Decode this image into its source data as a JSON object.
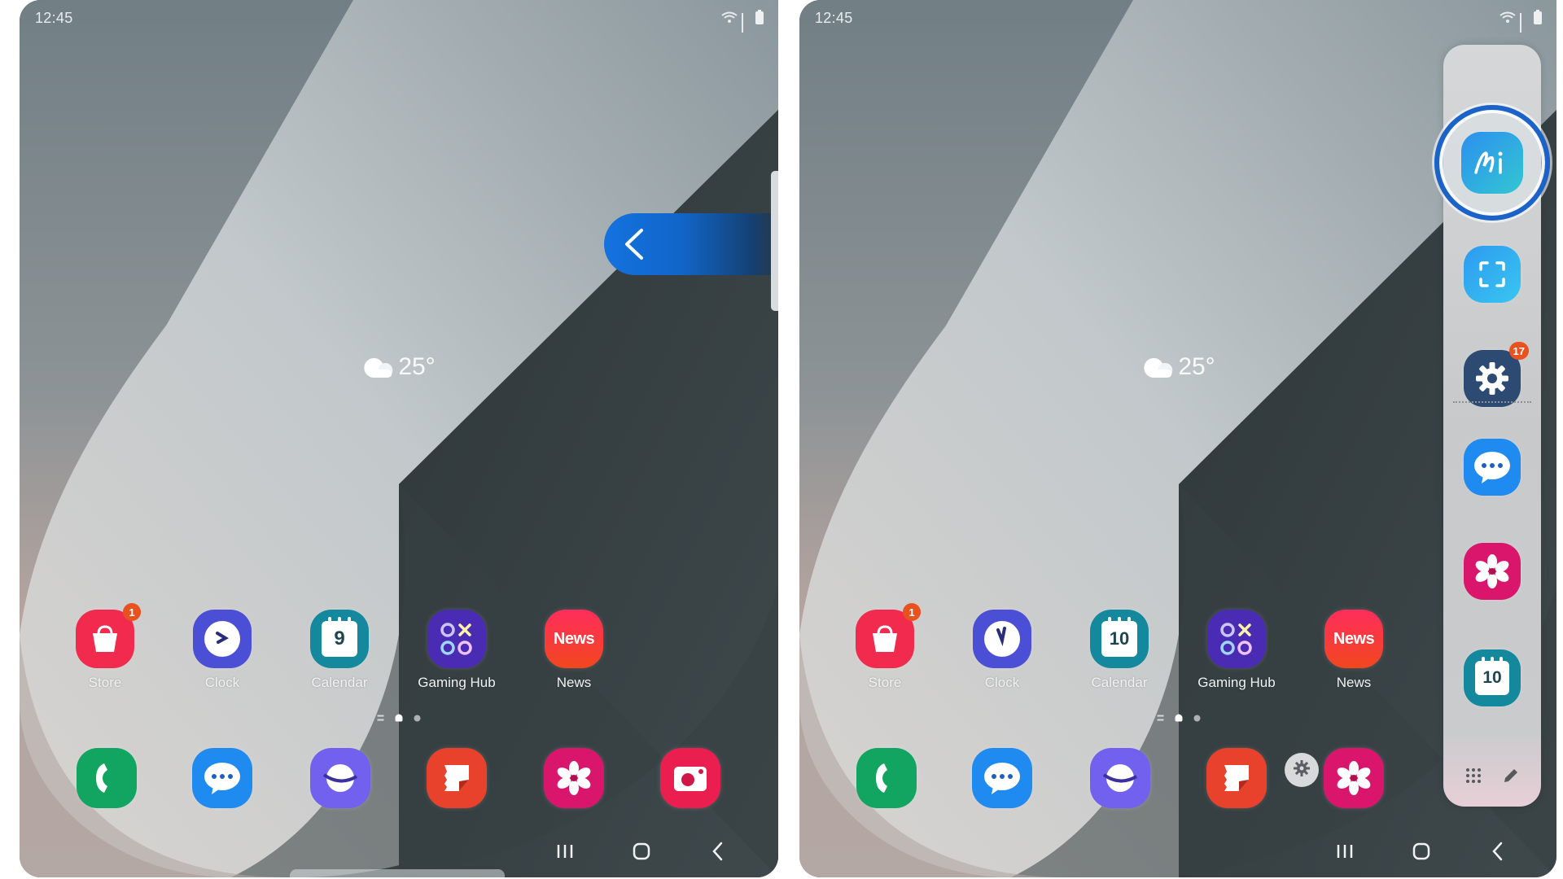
{
  "screens": [
    {
      "id": "left",
      "status_bar": {
        "time": "12:45",
        "icons": [
          "wifi-icon",
          "signal-icon",
          "battery-icon"
        ]
      },
      "weather": {
        "icon": "cloud-icon",
        "temperature": "25°"
      },
      "apps": [
        {
          "name": "store",
          "label": "Store",
          "icon": "shopping-bag-icon",
          "color": "#f22a4e",
          "badge": "1"
        },
        {
          "name": "clock",
          "label": "Clock",
          "icon": "clock-icon",
          "color": "#4a4fd6"
        },
        {
          "name": "calendar",
          "label": "Calendar",
          "icon": "calendar-icon",
          "color": "#14899e",
          "day": "9"
        },
        {
          "name": "gaming-hub",
          "label": "Gaming Hub",
          "icon": "gaming-hub-icon",
          "color": "#4a2bb3"
        },
        {
          "name": "news",
          "label": "News",
          "icon": "news-icon",
          "color": "#f3294f",
          "text": "News"
        }
      ],
      "page_indicator": {
        "pages": 2,
        "current": 1
      },
      "dock": [
        {
          "name": "phone",
          "icon": "phone-icon",
          "color": "#12a561"
        },
        {
          "name": "messages",
          "icon": "messages-icon",
          "color": "#1f8af0"
        },
        {
          "name": "internet",
          "icon": "internet-icon",
          "color": "#7161ee"
        },
        {
          "name": "notes",
          "icon": "notes-icon",
          "color": "#e8412c"
        },
        {
          "name": "gallery",
          "icon": "gallery-icon",
          "color": "#d9166b"
        },
        {
          "name": "camera",
          "icon": "camera-icon",
          "color": "#ea1f4f"
        }
      ],
      "edge_gesture": {
        "icon": "chevron-left-icon",
        "color": "#1472e0"
      },
      "nav": [
        "recents-icon",
        "home-icon",
        "back-icon"
      ]
    },
    {
      "id": "right",
      "status_bar": {
        "time": "12:45",
        "icons": [
          "wifi-icon",
          "signal-icon",
          "battery-icon"
        ]
      },
      "weather": {
        "icon": "cloud-icon",
        "temperature": "25°"
      },
      "apps": [
        {
          "name": "store",
          "label": "Store",
          "icon": "shopping-bag-icon",
          "color": "#f22a4e",
          "badge": "1"
        },
        {
          "name": "clock",
          "label": "Clock",
          "icon": "clock-icon",
          "color": "#4a4fd6"
        },
        {
          "name": "calendar",
          "label": "Calendar",
          "icon": "calendar-icon",
          "color": "#14899e",
          "day": "10"
        },
        {
          "name": "gaming-hub",
          "label": "Gaming Hub",
          "icon": "gaming-hub-icon",
          "color": "#4a2bb3"
        },
        {
          "name": "news",
          "label": "News",
          "icon": "news-icon",
          "color": "#f3294f",
          "text": "News"
        }
      ],
      "page_indicator": {
        "pages": 2,
        "current": 1
      },
      "dock": [
        {
          "name": "phone",
          "icon": "phone-icon",
          "color": "#12a561"
        },
        {
          "name": "messages",
          "icon": "messages-icon",
          "color": "#1f8af0"
        },
        {
          "name": "internet",
          "icon": "internet-icon",
          "color": "#7161ee"
        },
        {
          "name": "notes",
          "icon": "notes-icon",
          "color": "#e8412c"
        },
        {
          "name": "gallery",
          "icon": "gallery-icon",
          "color": "#d9166b"
        }
      ],
      "edge_panel": {
        "highlight_color": "#1b62c9",
        "items": [
          {
            "name": "ai-select",
            "icon": "ai-select-icon",
            "color": "#2b9be8",
            "highlighted": true
          },
          {
            "name": "screen-capture",
            "icon": "capture-frame-icon",
            "color": "#2fa6ee"
          },
          {
            "name": "settings",
            "icon": "gear-icon",
            "color": "#2d4a72",
            "badge": "17"
          },
          {
            "name": "messages",
            "icon": "messages-icon",
            "color": "#1f8af0"
          },
          {
            "name": "gallery",
            "icon": "gallery-icon",
            "color": "#d9166b"
          },
          {
            "name": "calendar",
            "icon": "calendar-icon",
            "color": "#14899e",
            "day": "10"
          }
        ],
        "footer": [
          "apps-grid-icon",
          "edit-pencil-icon"
        ],
        "settings_button": "gear-icon"
      },
      "nav": [
        "recents-icon",
        "home-icon",
        "back-icon"
      ]
    }
  ]
}
